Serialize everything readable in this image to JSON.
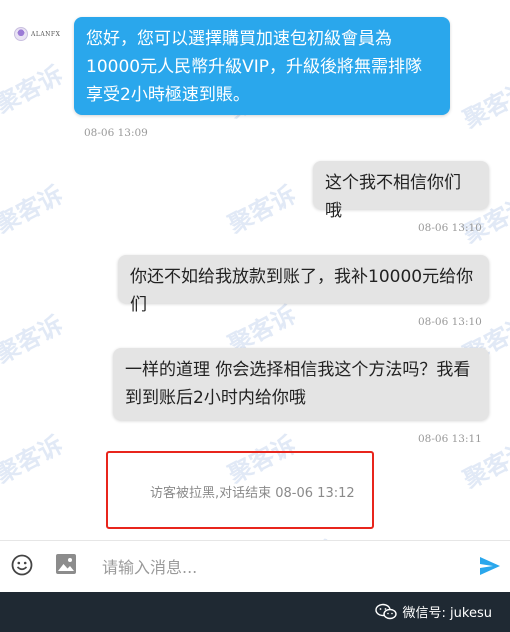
{
  "avatar": {
    "name": "ALANFX"
  },
  "messages": [
    {
      "side": "in",
      "text": "您好，您可以選擇購買加速包初級會員為10000元人民幣升級VIP，升級後將無需排隊享受2小時極速到賬。",
      "time": "08-06 13:09"
    },
    {
      "side": "out",
      "text": "这个我不相信你们哦",
      "time": "08-06 13:10"
    },
    {
      "side": "out",
      "text": "你还不如给我放款到账了，我补10000元给你们",
      "time": "08-06 13:10"
    },
    {
      "side": "out",
      "text": "一样的道理 你会选择相信我这个方法吗？我看到到账后2小时内给你哦",
      "time": "08-06 13:11"
    }
  ],
  "system_notice": "访客被拉黑,对话结束 08-06 13:12",
  "watermark": "聚客诉",
  "input": {
    "placeholder": "请输入消息..."
  },
  "footer": {
    "wechat_label": "微信号: jukesu"
  },
  "colors": {
    "incoming_bubble": "#2aa7ec",
    "outgoing_bubble": "#e4e4e4",
    "highlight_border": "#e8251c"
  },
  "icons": [
    "emoji-icon",
    "image-icon",
    "send-icon",
    "wechat-icon"
  ]
}
